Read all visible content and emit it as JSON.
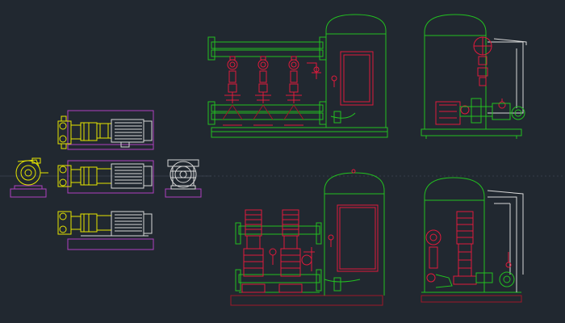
{
  "drawing": {
    "background_color": "#212830",
    "crosshair_color": "#4a5360",
    "colors": {
      "pump_outline": "#d8d8d8",
      "coupling": "#e6e600",
      "baseplate": "#b040c0",
      "pipe": "#22c020",
      "valve": "#e01a3c",
      "skid": "#a01828",
      "motor_detail": "#f0f0f0"
    }
  },
  "views": [
    {
      "id": "pump-plan-top",
      "kind": "horizontal-pump"
    },
    {
      "id": "pump-plan-middle",
      "kind": "horizontal-pump"
    },
    {
      "id": "pump-plan-bottom",
      "kind": "horizontal-pump"
    },
    {
      "id": "pump-end-view-left",
      "kind": "volute-end"
    },
    {
      "id": "pump-end-view-right",
      "kind": "motor-end"
    },
    {
      "id": "booster-set-front-a",
      "kind": "booster-front"
    },
    {
      "id": "booster-set-side-a",
      "kind": "booster-side"
    },
    {
      "id": "booster-set-front-b",
      "kind": "booster-front"
    },
    {
      "id": "booster-set-side-b",
      "kind": "booster-side"
    }
  ]
}
